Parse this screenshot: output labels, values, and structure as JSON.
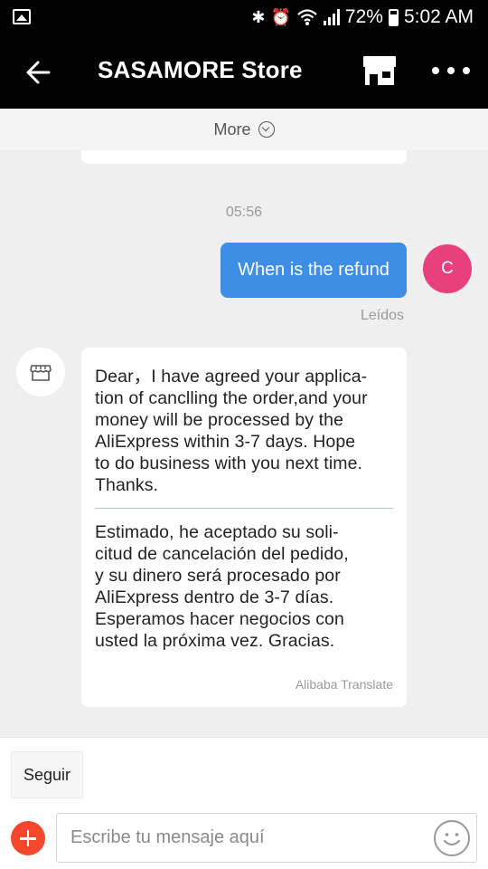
{
  "status_bar": {
    "battery": "72%",
    "time": "5:02 AM"
  },
  "header": {
    "title": "SASAMORE Store",
    "back_icon": "arrow-left-icon",
    "store_icon": "store-icon",
    "more_icon": "more-horizontal-icon"
  },
  "history": {
    "label": "More"
  },
  "messages": {
    "timestamp": "05:56",
    "outgoing": {
      "text": "When is the refund",
      "avatar_letter": "C",
      "status": "Leídos"
    },
    "incoming": {
      "lines_en": [
        "Dear，I have agreed your applica-",
        "tion of canclling the order,and your",
        "money will be processed by the",
        "AliExpress within 3-7 days. Hope",
        "to do business with you next time.",
        "Thanks."
      ],
      "lines_es": [
        "Estimado, he aceptado su soli-",
        "citud de cancelación del pedido,",
        "y su dinero será procesado por",
        "AliExpress dentro de 3-7 días.",
        "Esperamos hacer negocios con",
        "usted la próxima vez. Gracias."
      ],
      "translated_by": "Alibaba Translate"
    }
  },
  "footer": {
    "follow_label": "Seguir",
    "input_placeholder": "Escribe tu mensaje aquí",
    "add_icon": "plus-circle-icon",
    "emoji_icon": "smiley-icon"
  },
  "colors": {
    "outgoing_bubble": "#3d8ee4",
    "avatar": "#e8407c",
    "add_button": "#f4472b",
    "header": "#000000"
  }
}
